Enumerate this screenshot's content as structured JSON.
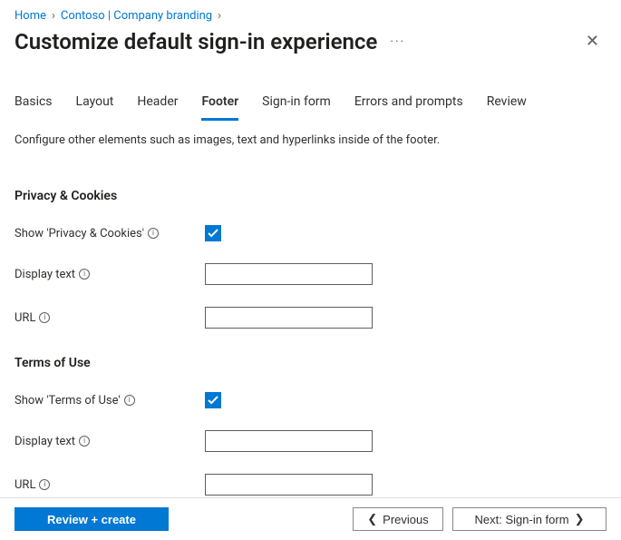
{
  "breadcrumb": {
    "home": "Home",
    "contoso": "Contoso | Company branding"
  },
  "header": {
    "title": "Customize default sign-in experience"
  },
  "tabs": [
    {
      "label": "Basics"
    },
    {
      "label": "Layout"
    },
    {
      "label": "Header"
    },
    {
      "label": "Footer"
    },
    {
      "label": "Sign-in form"
    },
    {
      "label": "Errors and prompts"
    },
    {
      "label": "Review"
    }
  ],
  "description": "Configure other elements such as images, text and hyperlinks inside of the footer.",
  "sections": {
    "privacy": {
      "heading": "Privacy & Cookies",
      "show_label": "Show 'Privacy & Cookies'",
      "display_text_label": "Display text",
      "display_text_value": "",
      "url_label": "URL",
      "url_value": ""
    },
    "terms": {
      "heading": "Terms of Use",
      "show_label": "Show 'Terms of Use'",
      "display_text_label": "Display text",
      "display_text_value": "",
      "url_label": "URL",
      "url_value": ""
    }
  },
  "footer_buttons": {
    "review_create": "Review + create",
    "previous": "Previous",
    "next": "Next: Sign-in form"
  }
}
